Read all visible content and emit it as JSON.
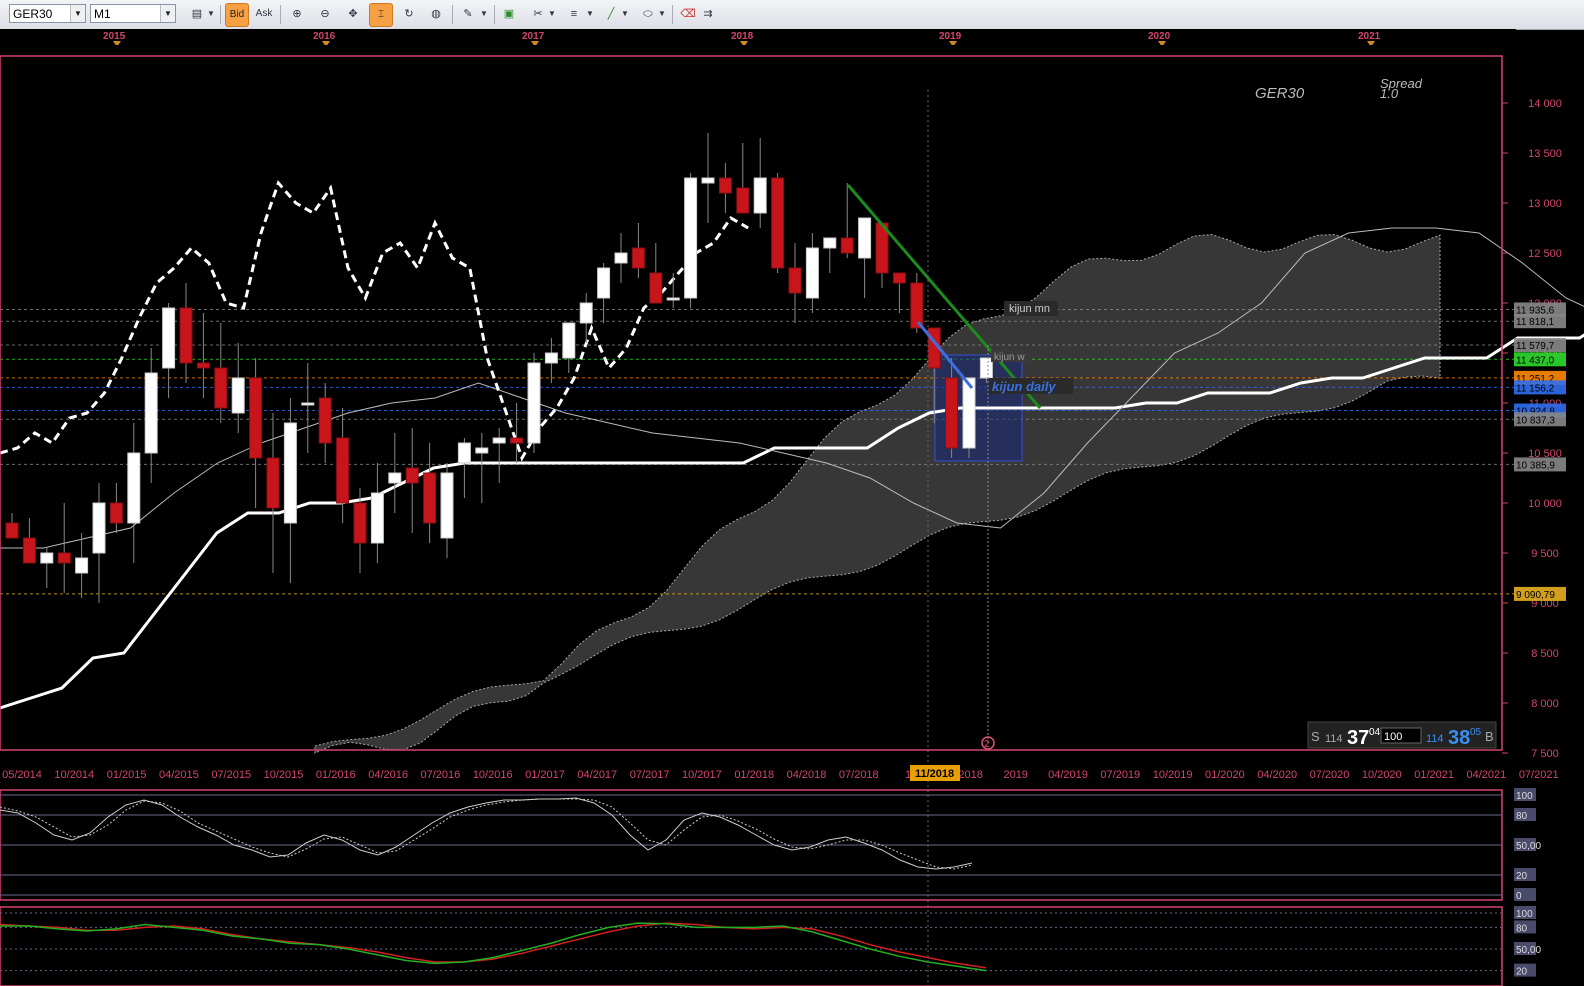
{
  "toolbar": {
    "symbol": "GER30",
    "timeframe": "M1",
    "bid_label": "Bid",
    "ask_label": "Ask"
  },
  "years": [
    "2015",
    "2016",
    "2017",
    "2018",
    "2019",
    "2020",
    "2021"
  ],
  "chart_title": "GER30",
  "spread_label": "Spread",
  "spread_value": "1.0",
  "trade_panel": {
    "sell_label": "S",
    "sell_small": "114",
    "sell_big": "37",
    "sell_sup": "04",
    "qty": "100",
    "buy_small": "114",
    "buy_big": "38",
    "buy_sup": "05",
    "buy_label": "B"
  },
  "annotations": {
    "kijun_mn": "kijun mn",
    "kijun_w": "kijun w",
    "kijun_daily": "kijun daily",
    "marker": "2",
    "cursor_date": "11/2018"
  },
  "colors": {
    "bear": "#c8151b",
    "bull": "#ffffff",
    "accent": "#d2456c",
    "trend": "#1c8a1c",
    "blue": "#3a6fe0",
    "cloud": "#3a3a3a"
  },
  "chart_data": [
    {
      "type": "line",
      "name": "price",
      "subtype": "candlestick with ichimoku",
      "ylim": [
        7500,
        14500
      ],
      "y_ticks": [
        "14 000",
        "13 500",
        "13 000",
        "12 500",
        "12 000",
        "11 500",
        "11 000",
        "10 500",
        "10 000",
        "9 500",
        "9 000",
        "8 500",
        "8 000",
        "7 500"
      ],
      "y_tick_values": [
        14000,
        13500,
        13000,
        12500,
        12000,
        11500,
        11000,
        10500,
        10000,
        9500,
        9000,
        8500,
        8000,
        7500
      ],
      "x_ticks": [
        "05/2014",
        "10/2014",
        "01/2015",
        "04/2015",
        "07/2015",
        "10/2015",
        "01/2016",
        "04/2016",
        "07/2016",
        "10/2016",
        "01/2017",
        "04/2017",
        "07/2017",
        "10/2017",
        "01/2018",
        "04/2018",
        "07/2018",
        "10",
        "11/2018",
        "2019",
        "04/2019",
        "07/2019",
        "10/2019",
        "01/2020",
        "04/2020",
        "07/2020",
        "10/2020",
        "01/2021",
        "04/2021",
        "07/2021"
      ],
      "candles": [
        [
          9800,
          9900,
          9650,
          9650
        ],
        [
          9650,
          9850,
          9400,
          9400
        ],
        [
          9400,
          9550,
          9150,
          9500
        ],
        [
          9500,
          10000,
          9100,
          9400
        ],
        [
          9300,
          9700,
          9050,
          9450
        ],
        [
          9500,
          10200,
          9000,
          10000
        ],
        [
          10000,
          10200,
          9700,
          9800
        ],
        [
          9800,
          10800,
          9400,
          10500
        ],
        [
          10500,
          11550,
          10200,
          11300
        ],
        [
          11350,
          12000,
          11050,
          11950
        ],
        [
          11950,
          12200,
          11200,
          11400
        ],
        [
          11400,
          11900,
          11050,
          11350
        ],
        [
          11350,
          11800,
          10800,
          10950
        ],
        [
          10900,
          11600,
          10700,
          11250
        ],
        [
          11250,
          11450,
          9950,
          10450
        ],
        [
          10450,
          10900,
          9300,
          9950
        ],
        [
          9800,
          11050,
          9200,
          10800
        ],
        [
          11000,
          11400,
          10500,
          11000
        ],
        [
          11050,
          11200,
          10400,
          10600
        ],
        [
          10650,
          10950,
          9800,
          10000
        ],
        [
          10000,
          10150,
          9300,
          9600
        ],
        [
          9600,
          10400,
          9400,
          10100
        ],
        [
          10200,
          10700,
          9900,
          10300
        ],
        [
          10350,
          10750,
          9700,
          10200
        ],
        [
          10300,
          10600,
          9600,
          9800
        ],
        [
          9650,
          10400,
          9450,
          10300
        ],
        [
          10400,
          10650,
          10050,
          10600
        ],
        [
          10500,
          10700,
          10000,
          10550
        ],
        [
          10600,
          10750,
          10200,
          10650
        ],
        [
          10650,
          11000,
          10400,
          10600
        ],
        [
          10600,
          11500,
          10500,
          11400
        ],
        [
          11400,
          11650,
          11200,
          11500
        ],
        [
          11450,
          11800,
          11300,
          11800
        ],
        [
          11800,
          12100,
          11600,
          12000
        ],
        [
          12050,
          12400,
          11800,
          12350
        ],
        [
          12400,
          12700,
          12200,
          12500
        ],
        [
          12550,
          12800,
          12250,
          12350
        ],
        [
          12300,
          12600,
          12000,
          12000
        ],
        [
          12050,
          12300,
          11950,
          12050
        ],
        [
          12050,
          13300,
          11950,
          13250
        ],
        [
          13200,
          13700,
          12800,
          13250
        ],
        [
          13250,
          13400,
          12900,
          13100
        ],
        [
          13150,
          13600,
          13000,
          12900
        ],
        [
          12900,
          13650,
          12750,
          13250
        ],
        [
          13250,
          13300,
          12300,
          12350
        ],
        [
          12350,
          12600,
          11800,
          12100
        ],
        [
          12050,
          12700,
          11900,
          12550
        ],
        [
          12550,
          12600,
          12300,
          12650
        ],
        [
          12650,
          13200,
          12450,
          12500
        ],
        [
          12450,
          12800,
          12050,
          12850
        ],
        [
          12800,
          12650,
          12150,
          12300
        ],
        [
          12300,
          12300,
          11900,
          12200
        ],
        [
          12200,
          12300,
          11700,
          11750
        ],
        [
          11750,
          11650,
          10800,
          11350
        ],
        [
          11250,
          11450,
          10450,
          10550
        ],
        [
          10550,
          11250,
          10450,
          11250
        ],
        [
          11250,
          11450,
          11200,
          11450
        ]
      ],
      "tenkan": [
        9550,
        9550,
        9650,
        9750,
        10100,
        10400,
        10600,
        10750,
        10900,
        11000,
        11050,
        11200,
        11050,
        10900,
        10800,
        10700,
        10650,
        10600,
        10500,
        10400,
        10250,
        10000,
        9800,
        9750,
        10100,
        10600,
        11050,
        11500,
        11700,
        12000,
        12500,
        12700,
        12750,
        12750,
        12700,
        12400,
        12050,
        11850,
        11700,
        11600
      ],
      "kijun": [
        7950,
        8050,
        8150,
        8450,
        8500,
        8900,
        9300,
        9700,
        9900,
        9900,
        10000,
        10000,
        10050,
        10200,
        10350,
        10400,
        10400,
        10400,
        10400,
        10400,
        10400,
        10400,
        10400,
        10400,
        10400,
        10550,
        10550,
        10550,
        10550,
        10750,
        10900,
        10950,
        10950,
        10950,
        10950,
        10950,
        10950,
        11000,
        11000,
        11100,
        11100,
        11100,
        11200,
        11250,
        11250,
        11350,
        11450,
        11450,
        11450,
        11650,
        11650,
        11650,
        11850,
        11850,
        11850,
        11850
      ],
      "chikou": [
        10500,
        10550,
        10700,
        10600,
        10850,
        10900,
        11100,
        11450,
        11850,
        12200,
        12350,
        12550,
        12400,
        12000,
        11950,
        12700,
        13200,
        13000,
        12900,
        13150,
        12350,
        12050,
        12500,
        12600,
        12350,
        12800,
        12450,
        12350,
        11450,
        10950,
        10450,
        10750,
        10950,
        11250,
        11750,
        11350,
        11550,
        11950,
        12100,
        12300,
        12500,
        12600,
        12850,
        12750
      ],
      "senkou_a_range": [
        7500,
        12600
      ],
      "senkou_b_range": [
        7500,
        11200
      ],
      "levels": [
        {
          "label": "11 935,6",
          "value": 11935.6,
          "color": "#888888"
        },
        {
          "label": "11 818,1",
          "value": 11818.1,
          "color": "#888888"
        },
        {
          "label": "11 579,7",
          "value": 11579.7,
          "color": "#888888"
        },
        {
          "label": "11 437,0",
          "value": 11437.0,
          "color": "#2cdc2c"
        },
        {
          "label": "11 251,2",
          "value": 11251.2,
          "color": "#ff8800"
        },
        {
          "label": "11 156,2",
          "value": 11156.2,
          "color": "#2f6ff0"
        },
        {
          "label": "10 924,8",
          "value": 10924.8,
          "color": "#2f6ff0"
        },
        {
          "label": "10 837,3",
          "value": 10837.3,
          "color": "#888888"
        },
        {
          "label": "10 385,9",
          "value": 10385.9,
          "color": "#888888"
        },
        {
          "label": "9 090,79",
          "value": 9090.79,
          "color": "#e8b020"
        }
      ]
    },
    {
      "type": "line",
      "name": "stochastic",
      "ylim": [
        0,
        100
      ],
      "y_ticks": [
        "100",
        "80",
        "50,00",
        "20",
        "0"
      ],
      "y_tick_values": [
        100,
        80,
        50,
        20,
        0
      ],
      "k": [
        85,
        82,
        72,
        60,
        55,
        62,
        78,
        90,
        95,
        90,
        78,
        68,
        60,
        50,
        45,
        38,
        40,
        52,
        60,
        55,
        45,
        40,
        48,
        60,
        72,
        82,
        88,
        92,
        95,
        95,
        96,
        96,
        97,
        92,
        80,
        60,
        45,
        55,
        75,
        82,
        78,
        70,
        60,
        50,
        45,
        48,
        55,
        58,
        52,
        45,
        35,
        28,
        26,
        28,
        32
      ],
      "d": [
        88,
        84,
        78,
        68,
        58,
        60,
        70,
        85,
        94,
        92,
        84,
        72,
        64,
        56,
        48,
        42,
        38,
        46,
        56,
        58,
        50,
        42,
        44,
        55,
        66,
        78,
        85,
        90,
        93,
        95,
        96,
        96,
        96,
        95,
        88,
        72,
        55,
        50,
        65,
        78,
        80,
        74,
        66,
        56,
        48,
        46,
        50,
        55,
        55,
        50,
        42,
        35,
        28,
        26,
        30
      ]
    },
    {
      "type": "line",
      "name": "macd",
      "ylim": [
        0,
        100
      ],
      "y_ticks": [
        "100",
        "80",
        "50,00",
        "20"
      ],
      "y_tick_values": [
        100,
        80,
        50,
        20
      ],
      "green": [
        82,
        82,
        78,
        75,
        78,
        84,
        80,
        76,
        68,
        64,
        58,
        56,
        50,
        42,
        34,
        30,
        32,
        38,
        48,
        58,
        70,
        80,
        86,
        85,
        80,
        80,
        80,
        82,
        74,
        62,
        50,
        40,
        32,
        26,
        20
      ],
      "red": [
        84,
        82,
        80,
        76,
        76,
        80,
        82,
        78,
        70,
        64,
        60,
        56,
        52,
        46,
        38,
        32,
        32,
        36,
        44,
        54,
        64,
        74,
        82,
        86,
        84,
        80,
        78,
        80,
        78,
        68,
        56,
        46,
        38,
        30,
        24
      ]
    }
  ]
}
